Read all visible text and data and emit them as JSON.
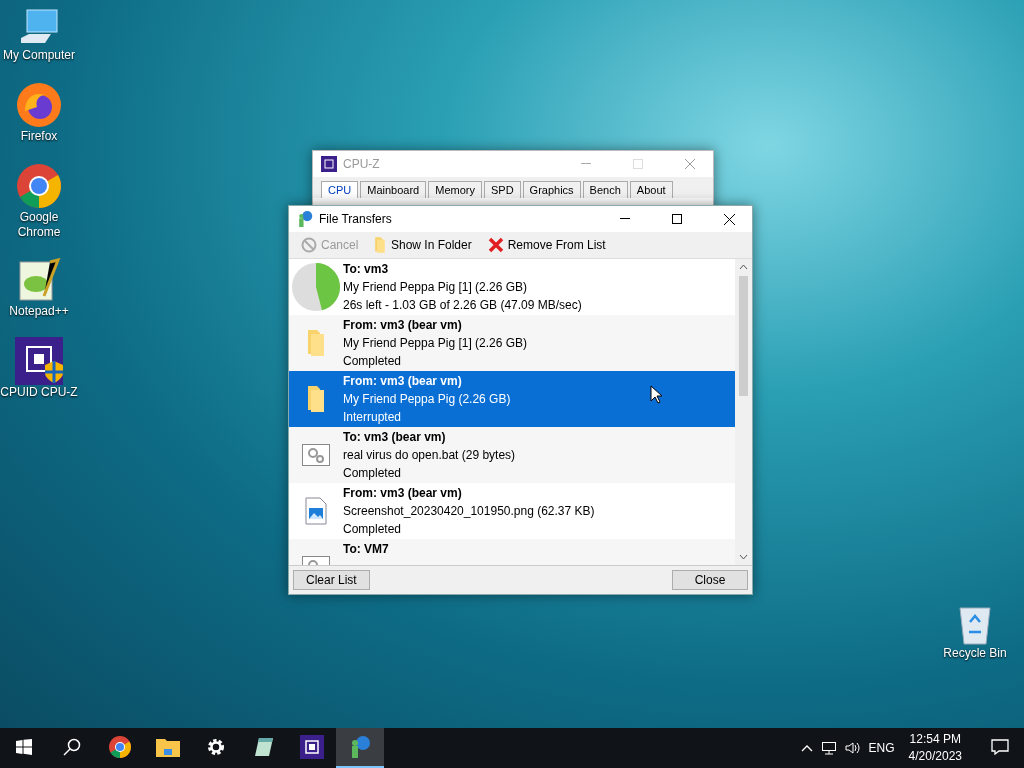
{
  "desktop_icons": [
    {
      "kind": "computer",
      "label": "My Computer"
    },
    {
      "kind": "firefox",
      "label": "Firefox"
    },
    {
      "kind": "chrome",
      "label": "Google Chrome"
    },
    {
      "kind": "notepad",
      "label": "Notepad++"
    },
    {
      "kind": "cpuz",
      "label": "CPUID CPU-Z"
    }
  ],
  "recycle_bin": {
    "label": "Recycle Bin"
  },
  "background_window": {
    "title": "CPU-Z",
    "tabs": [
      {
        "label": "CPU",
        "selected": true
      },
      {
        "label": "Mainboard",
        "selected": false
      },
      {
        "label": "Memory",
        "selected": false
      },
      {
        "label": "SPD",
        "selected": false
      },
      {
        "label": "Graphics",
        "selected": false
      },
      {
        "label": "Bench",
        "selected": false
      },
      {
        "label": "About",
        "selected": false
      }
    ]
  },
  "window": {
    "title": "File Transfers",
    "toolbar": [
      {
        "kind": "cancel",
        "label": "Cancel",
        "disabled": true
      },
      {
        "kind": "folder",
        "label": "Show In Folder",
        "disabled": false
      },
      {
        "kind": "remove",
        "label": "Remove From List",
        "disabled": false
      }
    ],
    "transfers": [
      {
        "kind": "progress",
        "level": 0.46,
        "selected": false,
        "heading": "To: vm3",
        "name": "My Friend Peppa Pig [1] (2.26 GB)",
        "status": "26s left - 1.03 GB of 2.26 GB (47.09 MB/sec)"
      },
      {
        "kind": "folder",
        "selected": false,
        "heading": "From: vm3 (bear vm)",
        "name": "My Friend Peppa Pig [1] (2.26 GB)",
        "status": "Completed"
      },
      {
        "kind": "folder",
        "selected": true,
        "heading": "From: vm3 (bear vm)",
        "name": "My Friend Peppa Pig (2.26 GB)",
        "status": "Interrupted"
      },
      {
        "kind": "script",
        "selected": false,
        "heading": "To: vm3 (bear vm)",
        "name": "real virus do open.bat (29 bytes)",
        "status": "Completed"
      },
      {
        "kind": "image",
        "selected": false,
        "heading": "From: vm3 (bear vm)",
        "name": "Screenshot_20230420_101950.png (62.37 KB)",
        "status": "Completed"
      },
      {
        "kind": "script",
        "selected": false,
        "heading": "To: VM7"
      }
    ],
    "buttons": [
      {
        "kind": "clear",
        "label": "Clear List"
      },
      {
        "kind": "close",
        "label": "Close"
      }
    ]
  },
  "taskbar": {
    "apps": [
      {
        "kind": "chrome",
        "selected": false
      },
      {
        "kind": "explorer",
        "selected": false
      },
      {
        "kind": "settings",
        "selected": false
      },
      {
        "kind": "notepad",
        "selected": false
      },
      {
        "kind": "cpuz",
        "selected": false
      },
      {
        "kind": "transfers",
        "selected": true
      }
    ],
    "language": "ENG",
    "time": "12:54 PM",
    "date": "4/20/2023"
  }
}
